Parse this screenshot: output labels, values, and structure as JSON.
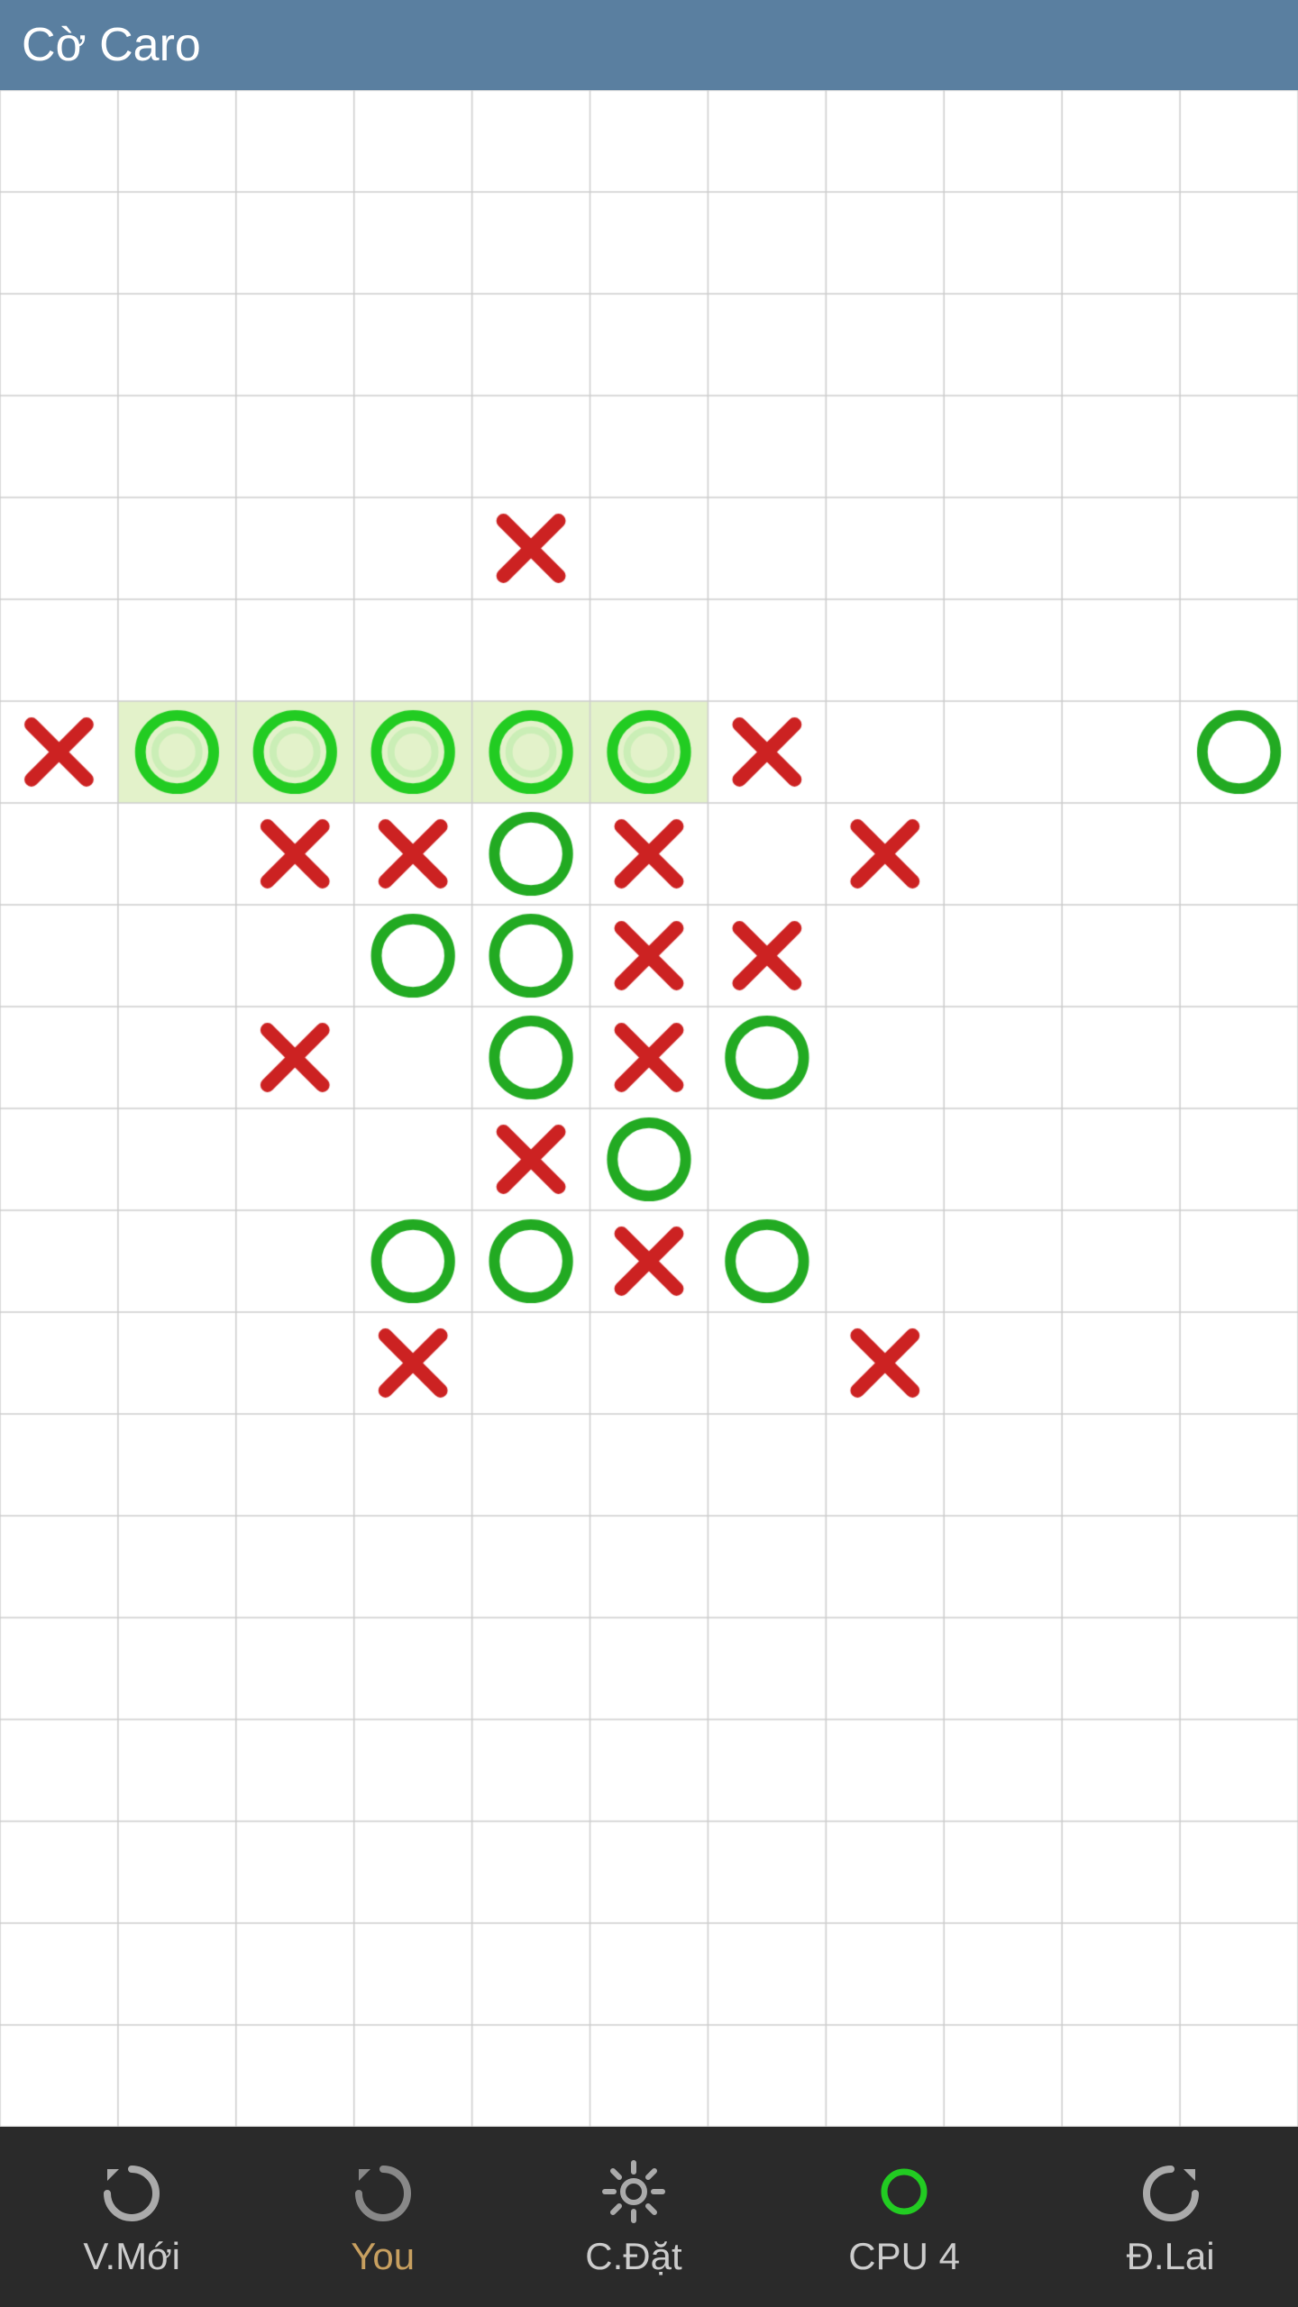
{
  "app": {
    "title": "Cờ Caro"
  },
  "bottom_bar": {
    "new_label": "V.Mới",
    "you_label": "You",
    "settings_label": "C.Đặt",
    "cpu_label": "CPU 4",
    "undo_label": "Đ.Lai"
  },
  "board": {
    "cols": 11,
    "rows": 20,
    "highlight_row": 6,
    "highlight_col_start": 1,
    "highlight_col_end": 5,
    "pieces": [
      {
        "r": 4,
        "c": 4,
        "t": "X"
      },
      {
        "r": 6,
        "c": 0,
        "t": "X"
      },
      {
        "r": 6,
        "c": 1,
        "t": "O",
        "hl": true
      },
      {
        "r": 6,
        "c": 2,
        "t": "O",
        "hl": true
      },
      {
        "r": 6,
        "c": 3,
        "t": "O",
        "hl": true
      },
      {
        "r": 6,
        "c": 4,
        "t": "O",
        "hl": true
      },
      {
        "r": 6,
        "c": 5,
        "t": "O",
        "hl": true
      },
      {
        "r": 6,
        "c": 6,
        "t": "X"
      },
      {
        "r": 6,
        "c": 10,
        "t": "O"
      },
      {
        "r": 7,
        "c": 2,
        "t": "X"
      },
      {
        "r": 7,
        "c": 3,
        "t": "X"
      },
      {
        "r": 7,
        "c": 4,
        "t": "O"
      },
      {
        "r": 7,
        "c": 5,
        "t": "X"
      },
      {
        "r": 7,
        "c": 7,
        "t": "X"
      },
      {
        "r": 8,
        "c": 3,
        "t": "O"
      },
      {
        "r": 8,
        "c": 4,
        "t": "O"
      },
      {
        "r": 8,
        "c": 5,
        "t": "X"
      },
      {
        "r": 8,
        "c": 6,
        "t": "X"
      },
      {
        "r": 9,
        "c": 2,
        "t": "X"
      },
      {
        "r": 9,
        "c": 4,
        "t": "O"
      },
      {
        "r": 9,
        "c": 5,
        "t": "X"
      },
      {
        "r": 9,
        "c": 6,
        "t": "O"
      },
      {
        "r": 10,
        "c": 4,
        "t": "X"
      },
      {
        "r": 10,
        "c": 5,
        "t": "O"
      },
      {
        "r": 11,
        "c": 3,
        "t": "O"
      },
      {
        "r": 11,
        "c": 4,
        "t": "O"
      },
      {
        "r": 11,
        "c": 5,
        "t": "X"
      },
      {
        "r": 11,
        "c": 6,
        "t": "O"
      },
      {
        "r": 12,
        "c": 3,
        "t": "X"
      },
      {
        "r": 12,
        "c": 7,
        "t": "X"
      }
    ]
  }
}
